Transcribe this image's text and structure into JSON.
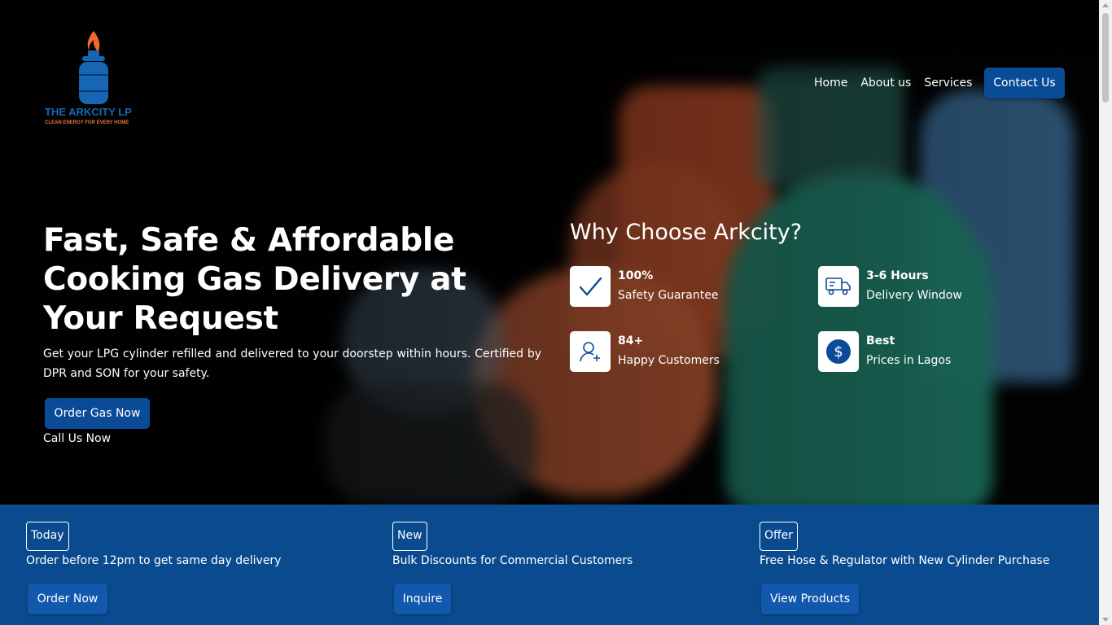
{
  "brand": {
    "name": "THE ARKCITY LP",
    "tagline": "CLEAN ENERGY FOR EVERY HOME",
    "colors": {
      "primary": "#0a4b97",
      "flame": "#f26b2c",
      "tank": "#1766b5"
    }
  },
  "nav": {
    "items": [
      "Home",
      "About us",
      "Services"
    ],
    "contact_label": "Contact Us"
  },
  "hero": {
    "headline": "Fast, Safe & Affordable Cooking Gas Delivery at Your Request",
    "subtext": "Get your LPG cylinder refilled and delivered to your doorstep within hours. Certified by DPR and SON for your safety.",
    "order_label": "Order Gas Now",
    "call_label": "Call Us Now"
  },
  "why": {
    "title": "Why Choose Arkcity?",
    "features": [
      {
        "icon": "checkmark-icon",
        "title": "100%",
        "desc": "Safety Guarantee"
      },
      {
        "icon": "delivery-truck-icon",
        "title": "3-6 Hours",
        "desc": "Delivery Window"
      },
      {
        "icon": "customers-icon",
        "title": "84+",
        "desc": "Happy Customers"
      },
      {
        "icon": "dollar-icon",
        "title": "Best",
        "desc": "Prices in Lagos"
      }
    ]
  },
  "promos": [
    {
      "badge": "Today",
      "text": "Order before 12pm to get same day delivery",
      "button": "Order Now"
    },
    {
      "badge": "New",
      "text": "Bulk Discounts for Commercial Customers",
      "button": "Inquire"
    },
    {
      "badge": "Offer",
      "text": "Free Hose & Regulator with New Cylinder Purchase",
      "button": "View Products"
    }
  ]
}
